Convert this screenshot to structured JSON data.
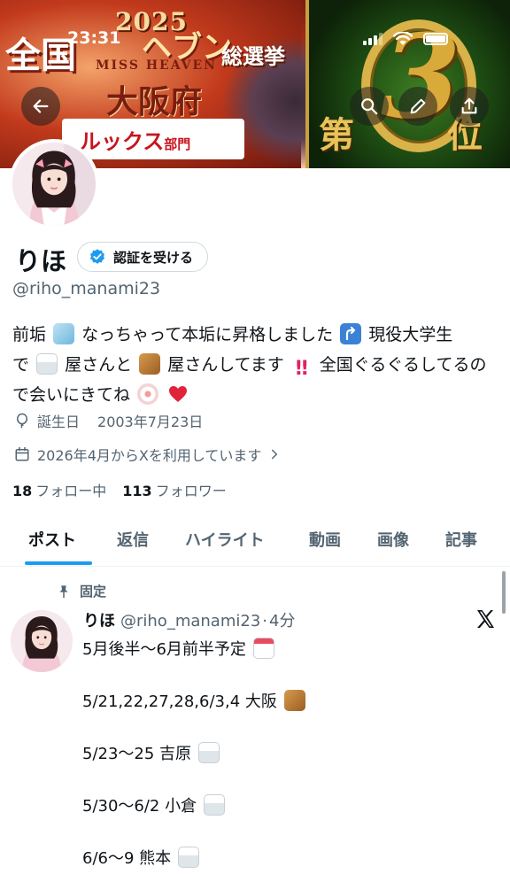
{
  "status_bar": {
    "time": "23:31"
  },
  "banner": {
    "year": "2025",
    "line1": "全国",
    "title": "ヘブン",
    "subtitle": "MISS HEAVEN",
    "election": "総選挙",
    "region": "大阪府",
    "category": "ルックス",
    "category_suffix": "部門",
    "rank_prefix": "第",
    "rank_number": "3",
    "rank_suffix": "位"
  },
  "profile": {
    "name": "りほ",
    "verify_button_label": "認証を受ける",
    "handle": "@riho_manami23",
    "bio_parts": {
      "p1": "前垢",
      "p2": "なっちゃって本垢に昇格しました",
      "p3": "現役大学生",
      "p4": "で",
      "p5": "屋さんと",
      "p6": "屋さんしてます",
      "p7": "全国ぐるぐるしてるので会いにきてね"
    },
    "birthday_label": "誕生日",
    "birthday_value": "2003年7月23日",
    "joined": "2026年4月からXを利用しています",
    "following_count": "18",
    "following_label": "フォロー中",
    "followers_count": "113",
    "followers_label": "フォロワー"
  },
  "tabs": [
    {
      "label": "ポスト",
      "active": true
    },
    {
      "label": "返信"
    },
    {
      "label": "ハイライト"
    },
    {
      "label": "動画"
    },
    {
      "label": "画像"
    },
    {
      "label": "記事"
    }
  ],
  "post": {
    "pinned_label": "固定",
    "author_name": "りほ",
    "author_handle": "@riho_manami23",
    "separator": "·",
    "time": "4分",
    "lines": [
      "5月後半〜6月前半予定",
      "5/21,22,27,28,6/3,4 大阪",
      "5/23〜25 吉原",
      "5/30〜6/2 小倉",
      "6/6〜9 熊本"
    ]
  },
  "colors": {
    "accent": "#1d9bf0",
    "text_primary": "#0f1419",
    "text_secondary": "#536471",
    "border": "#cfd9de"
  },
  "icons": {
    "back": "arrow-left-icon",
    "search": "search-icon",
    "edit": "pencil-icon",
    "share": "share-icon",
    "verified": "verified-badge-icon",
    "birthday": "balloon-icon",
    "calendar": "calendar-icon",
    "pin": "pin-icon",
    "x_logo": "x-logo-icon"
  }
}
